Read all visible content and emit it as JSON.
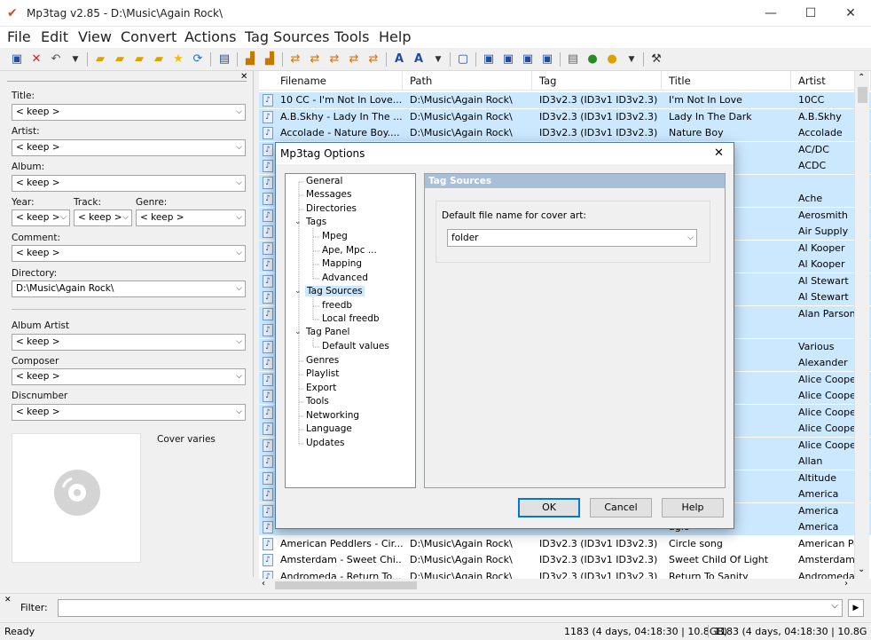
{
  "window": {
    "title": "Mp3tag v2.85  -  D:\\Music\\Again Rock\\",
    "minimize": "—",
    "maximize": "☐",
    "close": "✕"
  },
  "menu": [
    "File",
    "Edit",
    "View",
    "Convert",
    "Actions",
    "Tag Sources",
    "Tools",
    "Help"
  ],
  "panel": {
    "title_label": "Title:",
    "title_value": "< keep >",
    "artist_label": "Artist:",
    "artist_value": "< keep >",
    "album_label": "Album:",
    "album_value": "< keep >",
    "year_label": "Year:",
    "year_value": "< keep >",
    "track_label": "Track:",
    "track_value": "< keep >",
    "genre_label": "Genre:",
    "genre_value": "< keep >",
    "comment_label": "Comment:",
    "comment_value": "< keep >",
    "directory_label": "Directory:",
    "directory_value": "D:\\Music\\Again Rock\\",
    "albumartist_label": "Album Artist",
    "albumartist_value": "< keep >",
    "composer_label": "Composer",
    "composer_value": "< keep >",
    "discnumber_label": "Discnumber",
    "discnumber_value": "< keep >",
    "cover_text": "Cover varies",
    "close": "✕"
  },
  "grid": {
    "columns": [
      "Filename",
      "Path",
      "Tag",
      "Title",
      "Artist"
    ],
    "rows": [
      {
        "filename": "10 CC - I'm Not In Love....",
        "path": "D:\\Music\\Again Rock\\",
        "tag": "ID3v2.3 (ID3v1 ID3v2.3)",
        "title": "I'm Not In Love",
        "artist": "10CC"
      },
      {
        "filename": "A.B.Skhy - Lady In The ...",
        "path": "D:\\Music\\Again Rock\\",
        "tag": "ID3v2.3 (ID3v1 ID3v2.3)",
        "title": "Lady In The Dark",
        "artist": "A.B.Skhy"
      },
      {
        "filename": "Accolade - Nature Boy....",
        "path": "D:\\Music\\Again Rock\\",
        "tag": "ID3v2.3 (ID3v1 ID3v2.3)",
        "title": "Nature Boy",
        "artist": "Accolade"
      },
      {
        "filename": "",
        "path": "",
        "tag": "",
        "title": "",
        "artist": "AC/DC"
      },
      {
        "filename": "",
        "path": "",
        "tag": "",
        "title": "",
        "artist": "ACDC"
      },
      {
        "filename": "",
        "path": "",
        "tag": "",
        "title": "- simplic...",
        "artist": ""
      },
      {
        "filename": "",
        "path": "",
        "tag": "",
        "title": "",
        "artist": "Ache"
      },
      {
        "filename": "",
        "path": "",
        "tag": "",
        "title": "",
        "artist": "Aerosmith"
      },
      {
        "filename": "",
        "path": "",
        "tag": "",
        "title": "",
        "artist": "Air Supply"
      },
      {
        "filename": "",
        "path": "",
        "tag": "",
        "title": "egar",
        "artist": "Al Kooper"
      },
      {
        "filename": "",
        "path": "",
        "tag": "",
        "title": "e than y...",
        "artist": "Al Kooper"
      },
      {
        "filename": "",
        "path": "",
        "tag": "",
        "title": "e",
        "artist": "Al Stewart"
      },
      {
        "filename": "",
        "path": "",
        "tag": "",
        "title": "t",
        "artist": "Al Stewart"
      },
      {
        "filename": "",
        "path": "",
        "tag": "",
        "title": "",
        "artist": "Alan Parsons"
      },
      {
        "filename": "",
        "path": "",
        "tag": "",
        "title": "",
        "artist": ""
      },
      {
        "filename": "",
        "path": "",
        "tag": "",
        "title": "nd / It ne...",
        "artist": "Various"
      },
      {
        "filename": "",
        "path": "",
        "tag": "",
        "title": "ay",
        "artist": "Alexander"
      },
      {
        "filename": "",
        "path": "",
        "tag": "",
        "title": "Vithout You",
        "artist": "Alice Cooper"
      },
      {
        "filename": "",
        "path": "",
        "tag": "",
        "title": "",
        "artist": "Alice Cooper"
      },
      {
        "filename": "",
        "path": "",
        "tag": "",
        "title": "",
        "artist": "Alice Cooper"
      },
      {
        "filename": "",
        "path": "",
        "tag": "",
        "title": "",
        "artist": "Alice Cooper"
      },
      {
        "filename": "",
        "path": "",
        "tag": "",
        "title": "y Night...",
        "artist": "Alice Cooper"
      },
      {
        "filename": "",
        "path": "",
        "tag": "",
        "title": "Bad",
        "artist": "Allan"
      },
      {
        "filename": "",
        "path": "",
        "tag": "",
        "title": "",
        "artist": "Altitude"
      },
      {
        "filename": "",
        "path": "",
        "tag": "",
        "title": "No Name",
        "artist": "America"
      },
      {
        "filename": "",
        "path": "",
        "tag": "",
        "title": "",
        "artist": "America"
      },
      {
        "filename": "",
        "path": "",
        "tag": "",
        "title": "agic",
        "artist": "America"
      },
      {
        "filename": "American Peddlers - Cir...",
        "path": "D:\\Music\\Again Rock\\",
        "tag": "ID3v2.3 (ID3v1 ID3v2.3)",
        "title": "Circle song",
        "artist": "American Pe"
      },
      {
        "filename": "Amsterdam - Sweet Chi...",
        "path": "D:\\Music\\Again Rock\\",
        "tag": "ID3v2.3 (ID3v1 ID3v2.3)",
        "title": "Sweet Child Of Light",
        "artist": "Amsterdam"
      },
      {
        "filename": "Andromeda - Return To...",
        "path": "D:\\Music\\Again Rock\\",
        "tag": "ID3v2.3 (ID3v1 ID3v2.3)",
        "title": "Return To Sanity",
        "artist": "Andromeda"
      }
    ]
  },
  "filter": {
    "close": "✕",
    "label": "Filter:",
    "value": ""
  },
  "status": {
    "ready": "Ready",
    "info1": "1183 (4 days, 04:18:30 | 10.8GB)",
    "info2": "1183 (4 days, 04:18:30 | 10.8G"
  },
  "dialog": {
    "title": "Mp3tag Options",
    "close": "✕",
    "tree": [
      "General",
      "Messages",
      "Directories",
      "Tags",
      "Mpeg",
      "Ape, Mpc ...",
      "Mapping",
      "Advanced",
      "Tag Sources",
      "freedb",
      "Local freedb",
      "Tag Panel",
      "Default values",
      "Genres",
      "Playlist",
      "Export",
      "Tools",
      "Networking",
      "Language",
      "Updates"
    ],
    "section_title": "Tag Sources",
    "cover_label": "Default file name for cover art:",
    "cover_value": "folder",
    "ok": "OK",
    "cancel": "Cancel",
    "help": "Help"
  },
  "colors": {
    "selection": "#cce8ff",
    "accent": "#0078d7",
    "pane_header": "#a9bfd8"
  }
}
